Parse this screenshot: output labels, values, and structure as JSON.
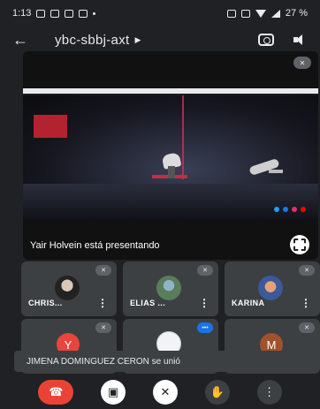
{
  "status_bar": {
    "time": "1:13",
    "battery": "27 %"
  },
  "top_bar": {
    "meeting_code": "ybc-sbbj-axt"
  },
  "presentation": {
    "presenter_label": "Yair Holvein está presentando",
    "muted": true
  },
  "participants": [
    {
      "name": "CHRIS...",
      "muted": true,
      "avatar": "photo"
    },
    {
      "name": "ELIAS ...",
      "muted": true,
      "avatar": "photo"
    },
    {
      "name": "KARINA",
      "muted": true,
      "avatar": "photo"
    },
    {
      "initial": "Y",
      "muted": true,
      "avatar_color": "#e8453c"
    },
    {
      "initial": "",
      "muted": false,
      "speaking": true,
      "avatar": "drawing"
    },
    {
      "initial": "M",
      "muted": true,
      "avatar_color": "#a0522d"
    }
  ],
  "toast": {
    "message": "JIMENA DOMINGUEZ CERON se unió"
  },
  "colors": {
    "accent_blue": "#1a73e8",
    "end_call_red": "#ea4335",
    "tile_bg": "#3c4043"
  },
  "icons": [
    "back-arrow-icon",
    "camera-switch-icon",
    "speaker-icon",
    "mic-off-icon",
    "fullscreen-icon",
    "end-call-icon",
    "camera-off-icon",
    "raise-hand-icon",
    "more-icon"
  ]
}
